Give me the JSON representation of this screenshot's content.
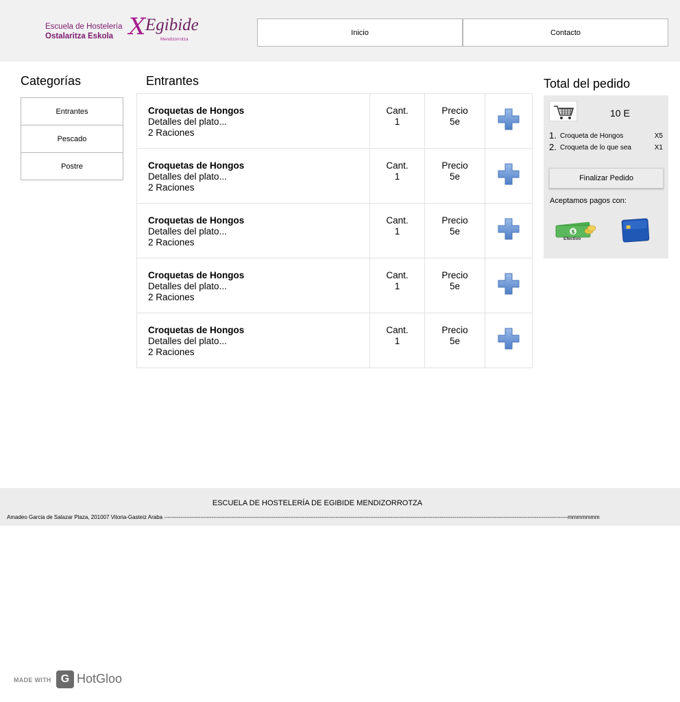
{
  "header": {
    "logo": {
      "line1": "Escuela de Hostelería",
      "line2": "Ostalaritza Eskola",
      "brand": "Egibide",
      "sub": "Mendizorrotza"
    },
    "nav": [
      {
        "label": "Inicio"
      },
      {
        "label": "Contacto"
      }
    ]
  },
  "categories": {
    "title": "Categorías",
    "items": [
      {
        "label": "Entrantes"
      },
      {
        "label": "Pescado"
      },
      {
        "label": "Postre"
      }
    ]
  },
  "products": {
    "title": "Entrantes",
    "rows": [
      {
        "name": "Croquetas de Hongos",
        "details": "Detalles del plato...",
        "portions": "2 Raciones",
        "qty_label": "Cant.",
        "qty": "1",
        "price_label": "Precio",
        "price": "5e",
        "add_icon": "plus-icon"
      },
      {
        "name": "Croquetas de Hongos",
        "details": "Detalles del plato...",
        "portions": "2 Raciones",
        "qty_label": "Cant.",
        "qty": "1",
        "price_label": "Precio",
        "price": "5e",
        "add_icon": "plus-icon"
      },
      {
        "name": "Croquetas de Hongos",
        "details": "Detalles del plato...",
        "portions": "2 Raciones",
        "qty_label": "Cant.",
        "qty": "1",
        "price_label": "Precio",
        "price": "5e",
        "add_icon": "plus-icon"
      },
      {
        "name": "Croquetas de Hongos",
        "details": "Detalles del plato...",
        "portions": "2 Raciones",
        "qty_label": "Cant.",
        "qty": "1",
        "price_label": "Precio",
        "price": "5e",
        "add_icon": "plus-icon"
      },
      {
        "name": "Croquetas de Hongos",
        "details": "Detalles del plato...",
        "portions": "2 Raciones",
        "qty_label": "Cant.",
        "qty": "1",
        "price_label": "Precio",
        "price": "5e",
        "add_icon": "plus-icon"
      }
    ]
  },
  "order": {
    "title": "Total del pedido",
    "cart_icon": "shopping-cart-icon",
    "total": "10 E",
    "items": [
      {
        "num": "1.",
        "name": "Croqueta de Hongos",
        "qty": "X5"
      },
      {
        "num": "2.",
        "name": "Croqueta de lo que sea",
        "qty": "X1"
      }
    ],
    "finish_label": "Finalizar Pedido",
    "payments_label": "Aceptamos pagos con:",
    "payments": [
      {
        "label": "Efectivo",
        "icon": "cash-icon"
      },
      {
        "icon": "credit-card-icon"
      }
    ]
  },
  "footer": {
    "title": "ESCUELA DE HOSTELERÍA DE EGIBIDE MENDIZORROTZA",
    "address": "Amadeo Garcia de Salazar Plaza, 201007 Vitoria-Gasteiz Araba  -----------------------------------------------------------------------------------------------------------------------------------------------------------------------------------------------------------------------------mmmmmmm"
  },
  "badge": {
    "made_with": "MADE WITH",
    "brand": "HotGloo"
  },
  "colors": {
    "header_bg": "#f1f1f1",
    "panel_bg": "#e9e9e9",
    "brand_purple": "#a51c8d",
    "plus_blue": "#6f9ad6"
  }
}
